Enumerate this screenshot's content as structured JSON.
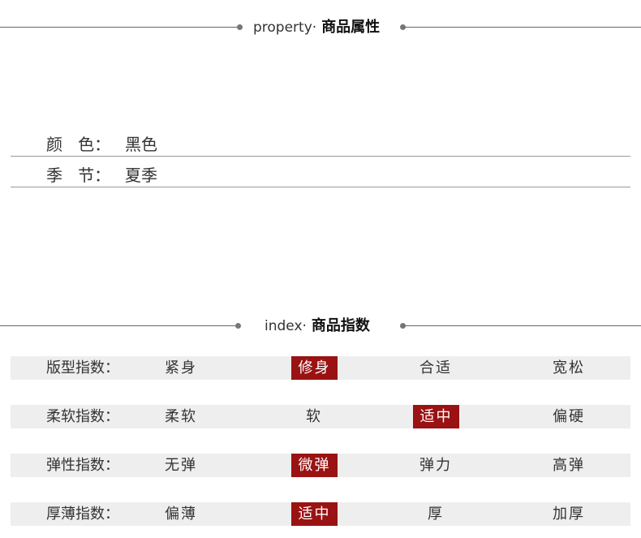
{
  "property_section": {
    "title_en": "property·",
    "title_zh": "商品属性",
    "rows": [
      {
        "label": "颜   色：",
        "value": "黑色"
      },
      {
        "label": "季   节：",
        "value": "夏季"
      }
    ]
  },
  "index_section": {
    "title_en": "index·",
    "title_zh": "商品指数",
    "rows": [
      {
        "label": "版型指数：",
        "options": [
          "紧身",
          "修身",
          "合适",
          "宽松"
        ],
        "selected": 1
      },
      {
        "label": "柔软指数：",
        "options": [
          "柔软",
          "软",
          "适中",
          "偏硬"
        ],
        "selected": 2
      },
      {
        "label": "弹性指数：",
        "options": [
          "无弹",
          "微弹",
          "弹力",
          "高弹"
        ],
        "selected": 1
      },
      {
        "label": "厚薄指数：",
        "options": [
          "偏薄",
          "适中",
          "厚",
          "加厚"
        ],
        "selected": 1
      }
    ]
  },
  "colors": {
    "selected_bg": "#9a1212",
    "row_bg": "#eeeeee",
    "divider": "#999999"
  }
}
